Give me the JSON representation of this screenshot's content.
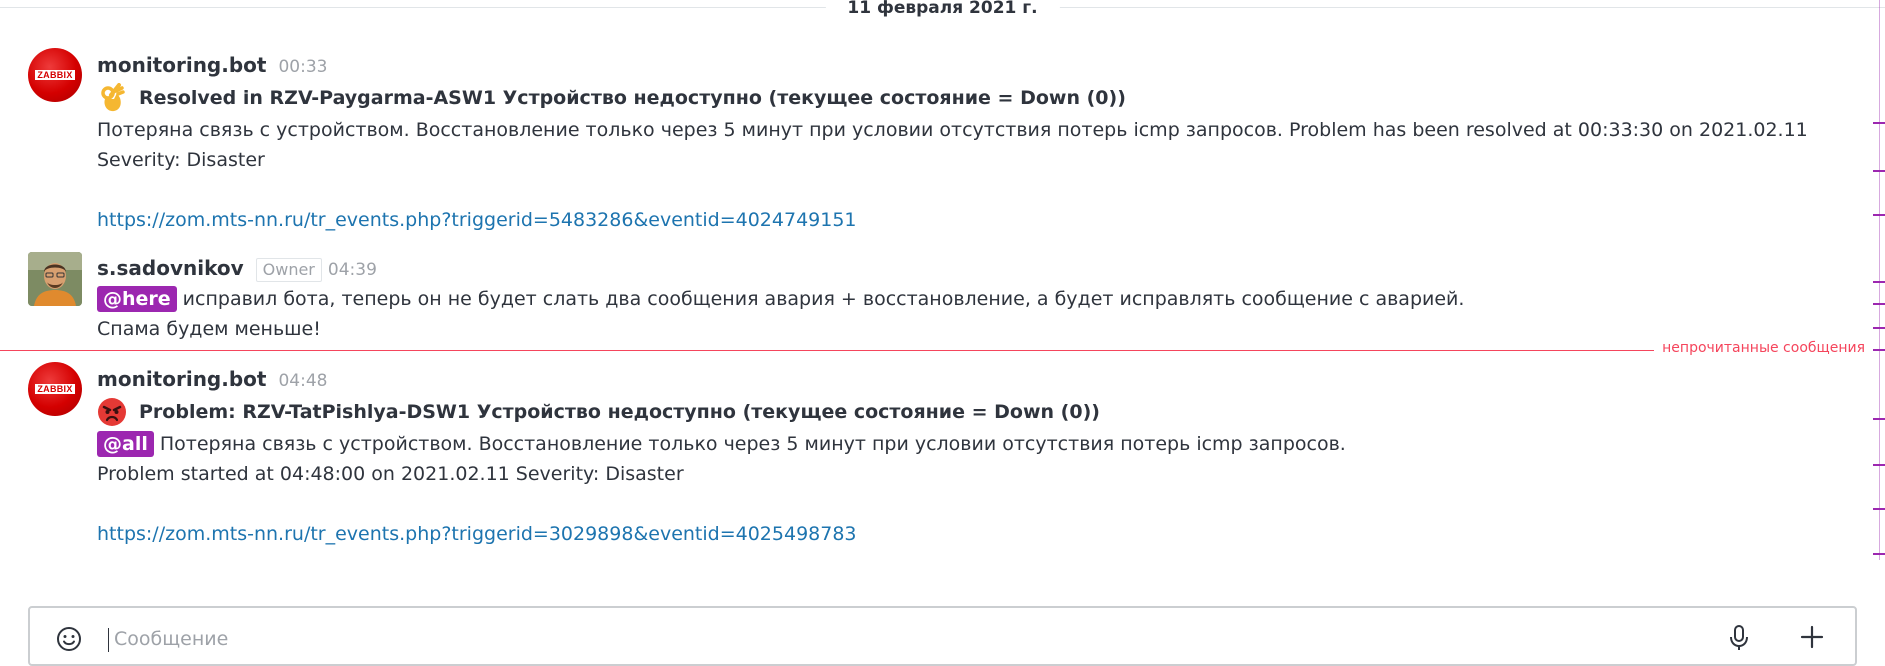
{
  "day_divider": "11 февраля 2021 г.",
  "messages": [
    {
      "author": "monitoring.bot",
      "time": "00:33",
      "avatar_text": "ZABBIX",
      "title": "Resolved in RZV-Paygarma-ASW1 Устройство недоступно (текущее состояние = Down (0))",
      "title_emoji": "ok-hand-icon",
      "body_line1": "Потеряна связь с устройством. Восстановление только через 5 минут при условии отсутствия потерь icmp запросов. Problem has been resolved at 00:33:30 on 2021.02.11",
      "body_line2": "Severity: Disaster",
      "link": "https://zom.mts-nn.ru/tr_events.php?triggerid=5483286&eventid=4024749151"
    },
    {
      "author": "s.sadovnikov",
      "role": "Owner",
      "time": "04:39",
      "mention": "@here",
      "body_line1": "исправил бота, теперь он не будет слать два сообщения авария + восстановление, а будет исправлять сообщение с аварией.",
      "body_line2": "Спама будем меньше!"
    },
    {
      "author": "monitoring.bot",
      "time": "04:48",
      "avatar_text": "ZABBIX",
      "title": "Problem: RZV-TatPishlya-DSW1 Устройство недоступно (текущее состояние = Down (0))",
      "title_emoji": "angry-face-icon",
      "mention": "@all",
      "body_line1": "Потеряна связь с устройством. Восстановление только через 5 минут при условии отсутствия потерь icmp запросов.",
      "body_line2": "Problem started at 04:48:00 on 2021.02.11 Severity: Disaster",
      "link": "https://zom.mts-nn.ru/tr_events.php?triggerid=3029898&eventid=4025498783"
    }
  ],
  "unread_label": "непрочитанные сообщения",
  "composer": {
    "placeholder": "Сообщение"
  },
  "colors": {
    "mention": "#9c27b0",
    "link": "#1d74af",
    "unread": "#f5455c"
  }
}
